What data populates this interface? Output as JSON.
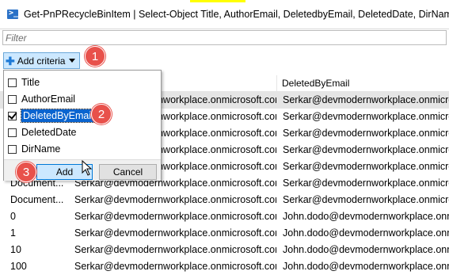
{
  "window": {
    "title": "Get-PnPRecycleBinItem | Select-Object Title, AuthorEmail, DeletedbyEmail, DeletedDate, DirName | Ou",
    "icon": "powershell-icon"
  },
  "filter": {
    "placeholder": "Filter"
  },
  "toolbar": {
    "add_criteria_label": "Add criteria"
  },
  "columns": [
    "DeletedByEmail"
  ],
  "rows": [
    {
      "c0": "",
      "c1": "Serkar@devmodernworkplace.onmicrosoft.com",
      "c2": "Serkar@devmodernworkplace.onmicrosoft.com",
      "selected": true
    },
    {
      "c0": "",
      "c1": "Serkar@devmodernworkplace.onmicrosoft.com",
      "c2": "Serkar@devmodernworkplace.onmicrosoft.com"
    },
    {
      "c0": "",
      "c1": "Serkar@devmodernworkplace.onmicrosoft.com",
      "c2": "Serkar@devmodernworkplace.onmicrosoft.com"
    },
    {
      "c0": "",
      "c1": "Serkar@devmodernworkplace.onmicrosoft.com",
      "c2": "Serkar@devmodernworkplace.onmicrosoft.com"
    },
    {
      "c0": "",
      "c1": "Serkar@devmodernworkplace.onmicrosoft.com",
      "c2": "Serkar@devmodernworkplace.onmicrosoft.com"
    },
    {
      "c0": "Document...",
      "c1": "Serkar@devmodernworkplace.onmicrosoft.com",
      "c2": "Serkar@devmodernworkplace.onmicrosoft.com"
    },
    {
      "c0": "Document...",
      "c1": "Serkar@devmodernworkplace.onmicrosoft.com",
      "c2": "Serkar@devmodernworkplace.onmicrosoft.com"
    },
    {
      "c0": "0",
      "c1": "Serkar@devmodernworkplace.onmicrosoft.com",
      "c2": "John.dodo@devmodernworkplace.onmicrosoft.com"
    },
    {
      "c0": "1",
      "c1": "Serkar@devmodernworkplace.onmicrosoft.com",
      "c2": "John.dodo@devmodernworkplace.onmicrosoft.com"
    },
    {
      "c0": "10",
      "c1": "Serkar@devmodernworkplace.onmicrosoft.com",
      "c2": "John.dodo@devmodernworkplace.onmicrosoft.com"
    },
    {
      "c0": "100",
      "c1": "Serkar@devmodernworkplace.onmicrosoft.com",
      "c2": "John.dodo@devmodernworkplace.onmicrosoft.com"
    }
  ],
  "criteria_popup": {
    "options": [
      {
        "label": "Title",
        "checked": false
      },
      {
        "label": "AuthorEmail",
        "checked": false
      },
      {
        "label": "DeletedByEmail",
        "checked": true
      },
      {
        "label": "DeletedDate",
        "checked": false
      },
      {
        "label": "DirName",
        "checked": false
      }
    ],
    "add_label": "Add",
    "cancel_label": "Cancel"
  },
  "badges": [
    "1",
    "2",
    "3"
  ],
  "colors": {
    "accent": "#0078d7",
    "badge": "#e8514b",
    "selection": "#0a64cf"
  }
}
